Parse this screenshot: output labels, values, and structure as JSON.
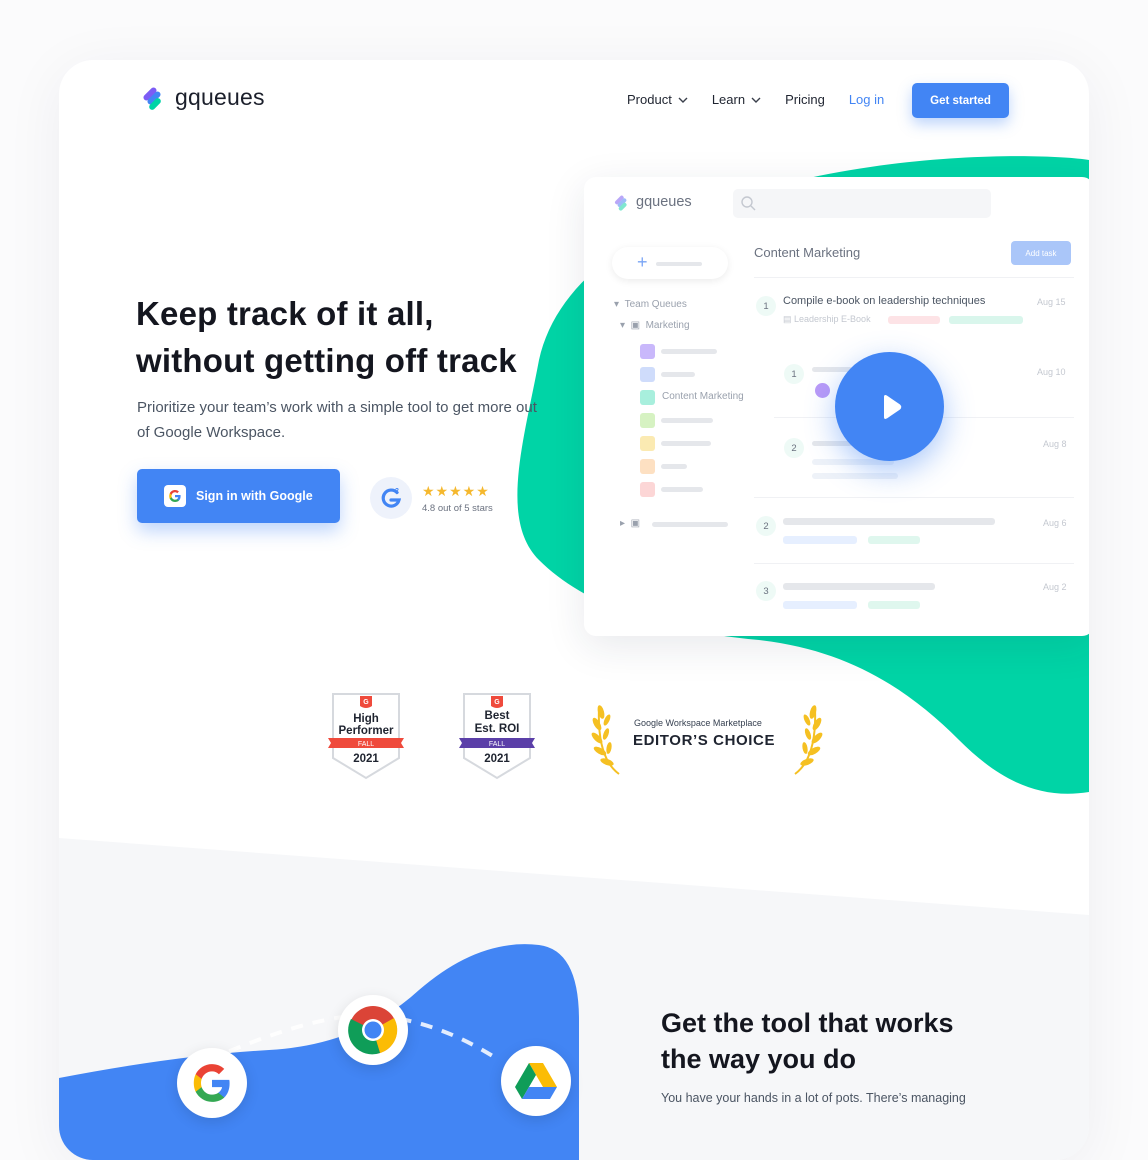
{
  "brand": {
    "name": "gqueues"
  },
  "nav": {
    "items": [
      {
        "label": "Product",
        "dropdown": true
      },
      {
        "label": "Learn",
        "dropdown": true
      },
      {
        "label": "Pricing",
        "dropdown": false
      }
    ],
    "login_label": "Log in",
    "cta_label": "Get started"
  },
  "hero": {
    "title_line1": "Keep track of it all,",
    "title_line2": "without getting off track",
    "subtitle": "Prioritize your team’s work with a simple tool to get more out of Google Workspace.",
    "google_button": "Sign in with Google",
    "rating_stars": "★★★★★",
    "rating_text": "4.8 out of 5 stars"
  },
  "app_preview": {
    "logo": "gqueues",
    "sidebar": {
      "team_queues": "Team Queues",
      "marketing": "Marketing",
      "content_marketing": "Content Marketing"
    },
    "queue_title": "Content Marketing",
    "add_task_label": "Add task",
    "tasks": [
      {
        "num": "1",
        "title": "Compile e-book on leadership techniques",
        "attachment": "Leadership E-Book",
        "date": "Aug 15"
      },
      {
        "num": "1",
        "date": "Aug 10"
      },
      {
        "num": "2",
        "date": "Aug 8"
      },
      {
        "num": "2",
        "date": "Aug 6"
      },
      {
        "num": "3",
        "date": "Aug 2"
      }
    ]
  },
  "badges": [
    {
      "top": "High",
      "bottom": "Performer",
      "season": "FALL",
      "year": "2021",
      "ribbon_color": "#ef4a3c"
    },
    {
      "top": "Best",
      "bottom": "Est. ROI",
      "season": "FALL",
      "year": "2021",
      "ribbon_color": "#5b3fa8"
    }
  ],
  "editors_choice": {
    "small": "Google Workspace Marketplace",
    "big": "EDITOR’S CHOICE"
  },
  "section2": {
    "title_line1": "Get the tool that works",
    "title_line2": "the way you do",
    "paragraph": "You have your hands in a lot of pots. There’s managing"
  },
  "colors": {
    "accent": "#4285f4",
    "green": "#00d4a6",
    "star": "#f5b82e"
  },
  "icons": [
    "gqueues-logo-icon",
    "chevron-down-icon",
    "google-g-icon",
    "g2-icon",
    "search-icon",
    "plus-icon",
    "play-icon",
    "laurel-icon",
    "chrome-icon",
    "drive-icon"
  ]
}
